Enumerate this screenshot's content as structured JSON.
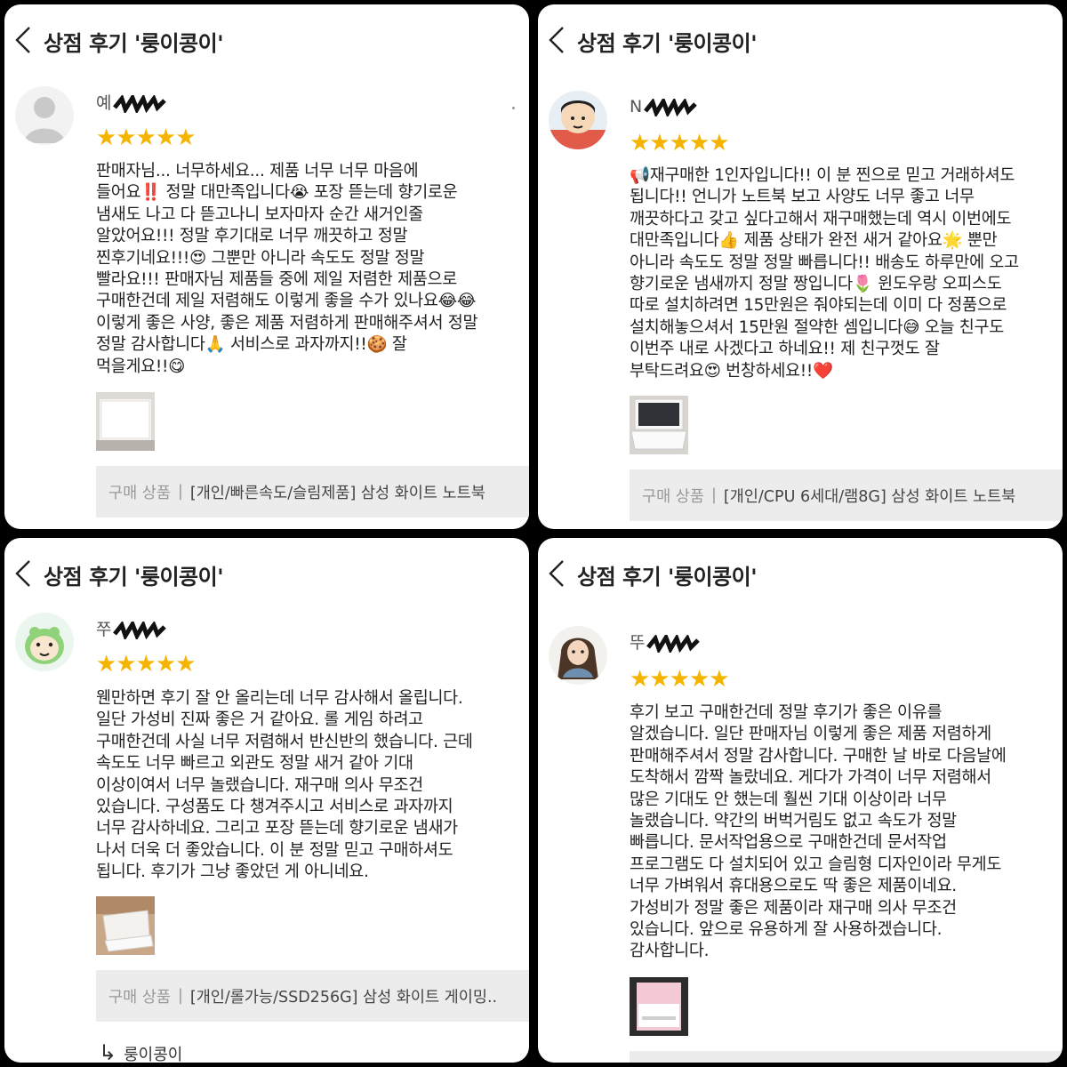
{
  "colors": {
    "star": "#f5b400",
    "background": "#000000",
    "panel": "#ffffff",
    "product_bar": "#ececec"
  },
  "panels": [
    {
      "header_title": "상점 후기 '룽이콩이'",
      "reviewer_visible": "예",
      "stars": "★★★★★",
      "rating": 5,
      "text": "판매자님... 너무하세요... 제품 너무 너무 마음에\n들어요‼️ 정말 대만족입니다😭 포장 뜯는데 향기로운\n냄새도 나고 다 뜯고나니 보자마자 순간 새거인줄\n알았어요!!! 정말 후기대로 너무 깨끗하고 정말\n찐후기네요!!!😍 그뿐만 아니라 속도도 정말 정말\n빨라요!!! 판매자님 제품들 중에 제일 저렴한 제품으로\n구매한건데 제일 저렴해도 이렇게 좋을 수가 있나요😂😂\n이렇게 좋은 사양, 좋은 제품 저렴하게 판매해주셔서 정말\n정말 감사합니다🙏 서비스로 과자까지!!🍪 잘\n먹을게요!!😋",
      "product_label": "구매 상품",
      "product_name": "[개인/빠른속도/슬림제품] 삼성 화이트 노트북"
    },
    {
      "header_title": "상점 후기 '룽이콩이'",
      "reviewer_visible": "N",
      "stars": "★★★★★",
      "rating": 5,
      "text": "📢재구매한 1인자입니다!! 이 분 찐으로 믿고 거래하셔도\n됩니다!! 언니가 노트북 보고 사양도 너무 좋고 너무\n깨끗하다고 갖고 싶다고해서 재구매했는데 역시 이번에도\n대만족입니다👍 제품 상태가 완전 새거 같아요🌟 뿐만\n아니라 속도도 정말 정말 빠릅니다!! 배송도 하루만에 오고\n향기로운 냄새까지 정말 짱입니다🌷 윈도우랑 오피스도\n따로 설치하려면 15만원은 줘야되는데 이미 다 정품으로\n설치해놓으셔서 15만원 절약한 셈입니다😅 오늘 친구도\n이번주 내로 사겠다고 하네요!! 제 친구껏도 잘\n부탁드려요😍 번창하세요!!❤️",
      "product_label": "구매 상품",
      "product_name": "[개인/CPU 6세대/램8G] 삼성 화이트 노트북"
    },
    {
      "header_title": "상점 후기 '룽이콩이'",
      "reviewer_visible": "쭈",
      "stars": "★★★★★",
      "rating": 5,
      "text": "웬만하면 후기 잘 안 올리는데 너무 감사해서 올립니다.\n일단 가성비 진짜 좋은 거 같아요. 롤 게임 하려고\n구매한건데 사실 너무 저렴해서 반신반의 했습니다. 근데\n속도도 너무 빠르고 외관도 정말 새거 같아 기대\n이상이여서 너무 놀랬습니다. 재구매 의사 무조건\n있습니다. 구성품도 다 챙겨주시고 서비스로 과자까지\n너무 감사하네요. 그리고 포장 뜯는데 향기로운 냄새가\n나서 더욱 더 좋았습니다. 이 분 정말 믿고 구매하셔도\n됩니다. 후기가 그냥 좋았던 게 아니네요.",
      "product_label": "구매 상품",
      "product_name": "[개인/롤가능/SSD256G] 삼성 화이트 게이밍..",
      "reply_name": "룽이콩이"
    },
    {
      "header_title": "상점 후기 '룽이콩이'",
      "reviewer_visible": "뚜",
      "stars": "★★★★★",
      "rating": 5,
      "text": "후기 보고 구매한건데 정말 후기가 좋은 이유를\n알겠습니다. 일단 판매자님 이렇게 좋은 제품 저렴하게\n판매해주셔서 정말 감사합니다. 구매한 날  바로 다음날에\n도착해서 깜짝 놀랐네요. 게다가 가격이 너무 저렴해서\n많은 기대도 안 했는데 훨씬 기대 이상이라 너무\n놀랬습니다. 약간의 버벅거림도 없고 속도가 정말\n빠릅니다. 문서작업용으로 구매한건데 문서작업\n프로그램도 다 설치되어 있고 슬림형 디자인이라 무게도\n너무 가벼워서 휴대용으로도 딱 좋은 제품이네요.\n가성비가 정말 좋은 제품이라 재구매 의사 무조건\n있습니다. 앞으로 유용하게 잘 사용하겠습니다.\n감사합니다."
    }
  ]
}
